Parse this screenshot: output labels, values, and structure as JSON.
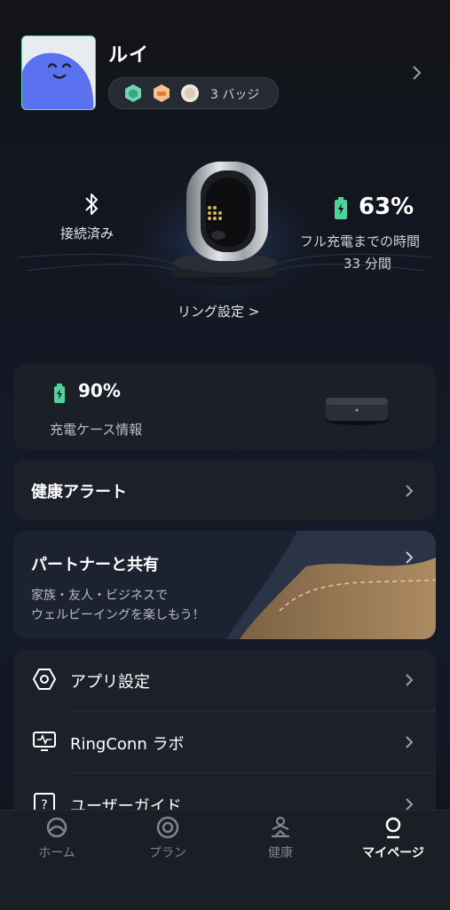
{
  "profile": {
    "name": "ルイ",
    "badges_label": "3 バッジ"
  },
  "ring": {
    "connection": "接続済み",
    "battery": "63%",
    "charge_label": "フル充電までの時間",
    "charge_time": "33 分間",
    "settings_link": "リング設定 >"
  },
  "case": {
    "battery": "90%",
    "label": "充電ケース情報"
  },
  "alerts": {
    "label": "健康アラート"
  },
  "partner": {
    "title": "パートナーと共有",
    "desc_line1": "家族・友人・ビジネスで",
    "desc_line2": "ウェルビーイングを楽しもう！"
  },
  "settings_list": [
    {
      "label": "アプリ設定",
      "icon": "hexagon-settings-icon"
    },
    {
      "label": "RingConn ラボ",
      "icon": "monitor-lab-icon"
    },
    {
      "label": "ユーザーガイド",
      "icon": "help-guide-icon"
    }
  ],
  "nav": [
    {
      "label": "ホーム",
      "icon": "home-ring-icon"
    },
    {
      "label": "プラン",
      "icon": "plan-circle-icon"
    },
    {
      "label": "健康",
      "icon": "health-person-icon"
    },
    {
      "label": "マイページ",
      "icon": "profile-icon",
      "active": true
    }
  ],
  "colors": {
    "accent_green": "#4fd39a",
    "card_bg": "#1c2029",
    "background": "#131722"
  }
}
